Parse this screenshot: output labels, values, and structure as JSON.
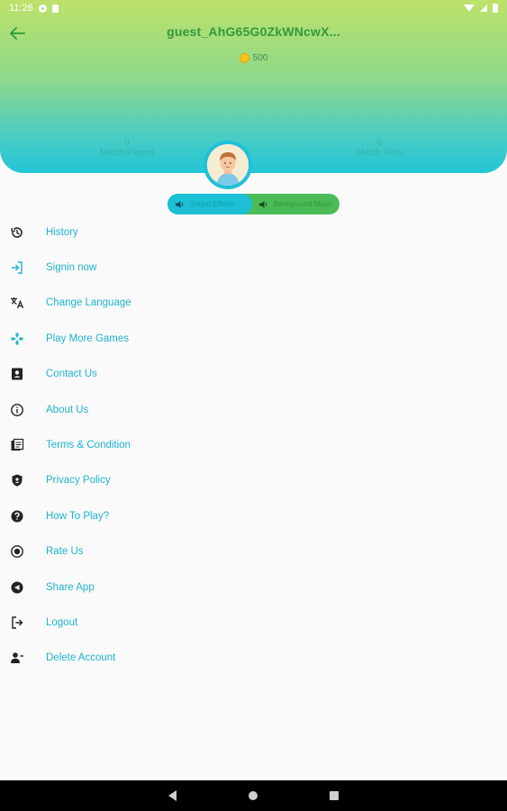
{
  "status_bar": {
    "time": "11:26"
  },
  "header": {
    "username": "guest_AhG65G0ZkWNcwX...",
    "coins": "500",
    "stats": [
      {
        "value": "0",
        "label": "Match Played"
      },
      {
        "value": "0",
        "label": "Match Won"
      }
    ]
  },
  "sound_toggle": {
    "left_label": "Sound Effects",
    "right_label": "Background Music"
  },
  "menu": {
    "items": [
      {
        "label": "History",
        "icon": "history-icon"
      },
      {
        "label": "Signin now",
        "icon": "login-icon"
      },
      {
        "label": "Change Language",
        "icon": "translate-icon"
      },
      {
        "label": "Play More Games",
        "icon": "gamepad-icon"
      },
      {
        "label": "Contact Us",
        "icon": "contact-icon"
      },
      {
        "label": "About Us",
        "icon": "info-icon"
      },
      {
        "label": "Terms & Condition",
        "icon": "terms-icon"
      },
      {
        "label": "Privacy Policy",
        "icon": "shield-icon"
      },
      {
        "label": "How To Play?",
        "icon": "help-icon"
      },
      {
        "label": "Rate Us",
        "icon": "rate-icon"
      },
      {
        "label": "Share App",
        "icon": "share-icon"
      },
      {
        "label": "Logout",
        "icon": "logout-icon"
      },
      {
        "label": "Delete Account",
        "icon": "delete-account-icon"
      }
    ]
  },
  "colors": {
    "accent": "#1fb3cf",
    "header_top": "#bde26a",
    "header_bottom": "#22c5d6",
    "username": "#2e9a3c",
    "toggle_left": "#1cbfd3",
    "toggle_right": "#4bbb58"
  }
}
